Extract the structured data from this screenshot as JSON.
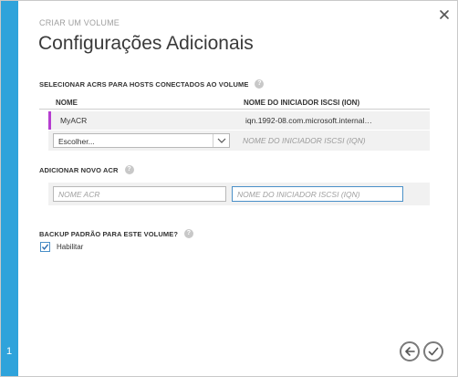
{
  "wizard": {
    "eyebrow": "CRIAR UM VOLUME",
    "title": "Configurações Adicionais",
    "step_number": "1",
    "accent_color": "#2fa3db"
  },
  "acr_section": {
    "label": "SELECIONAR ACRS PARA HOSTS CONECTADOS AO VOLUME",
    "columns": {
      "name": "NOME",
      "ion": "NOME DO INICIADOR ISCSI (ION)"
    },
    "rows": [
      {
        "name": "MyACR",
        "ion": "iqn.1992-08.com.microsoft.internal…",
        "selected_color": "#b53ed0"
      }
    ],
    "new_row": {
      "select_value": "Escolher...",
      "ion_placeholder": "NOME DO INICIADOR ISCSI (IQN)"
    }
  },
  "add_acr": {
    "label": "ADICIONAR NOVO ACR",
    "name_placeholder": "NOME ACR",
    "ion_placeholder": "NOME DO INICIADOR ISCSI (IQN)"
  },
  "backup": {
    "label": "BACKUP PADRÃO PARA ESTE VOLUME?",
    "checkbox_label": "Habilitar",
    "checked": true
  },
  "icons": {
    "help": "?",
    "close": "close-icon",
    "back": "arrow-left-icon",
    "finish": "checkmark-icon"
  }
}
